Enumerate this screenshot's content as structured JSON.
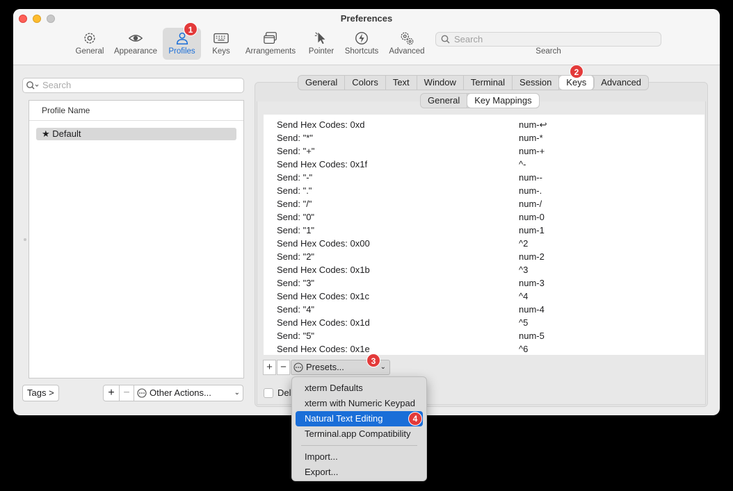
{
  "window": {
    "title": "Preferences"
  },
  "toolbar": {
    "items": [
      {
        "label": "General",
        "icon": "gear-icon"
      },
      {
        "label": "Appearance",
        "icon": "eye-icon"
      },
      {
        "label": "Profiles",
        "icon": "person-icon",
        "active": true
      },
      {
        "label": "Keys",
        "icon": "keyboard-icon"
      },
      {
        "label": "Arrangements",
        "icon": "windows-icon"
      },
      {
        "label": "Pointer",
        "icon": "pointer-icon"
      },
      {
        "label": "Shortcuts",
        "icon": "bolt-icon"
      },
      {
        "label": "Advanced",
        "icon": "gears-icon"
      }
    ],
    "search_placeholder": "Search",
    "search_label": "Search"
  },
  "badges": [
    "1",
    "2",
    "3",
    "4"
  ],
  "left": {
    "search_placeholder": "Search",
    "column_header": "Profile Name",
    "profiles": [
      {
        "name": "Default",
        "icon": "star-icon"
      }
    ],
    "tags_button": "Tags >",
    "add": "+",
    "remove": "−",
    "other_actions": "Other Actions..."
  },
  "tabs": [
    "General",
    "Colors",
    "Text",
    "Window",
    "Terminal",
    "Session",
    "Keys",
    "Advanced"
  ],
  "selected_tab": "Keys",
  "subtabs": [
    "General",
    "Key Mappings"
  ],
  "selected_subtab": "Key Mappings",
  "mappings": [
    {
      "action": "Send Hex Codes: 0xd",
      "key": "num-↩"
    },
    {
      "action": "Send: \"*\"",
      "key": "num-*"
    },
    {
      "action": "Send: \"+\"",
      "key": "num-+"
    },
    {
      "action": "Send Hex Codes: 0x1f",
      "key": "^-"
    },
    {
      "action": "Send: \"-\"",
      "key": "num--"
    },
    {
      "action": "Send: \".\"",
      "key": "num-."
    },
    {
      "action": "Send: \"/\"",
      "key": "num-/"
    },
    {
      "action": "Send: \"0\"",
      "key": "num-0"
    },
    {
      "action": "Send: \"1\"",
      "key": "num-1"
    },
    {
      "action": "Send Hex Codes: 0x00",
      "key": "^2"
    },
    {
      "action": "Send: \"2\"",
      "key": "num-2"
    },
    {
      "action": "Send Hex Codes: 0x1b",
      "key": "^3"
    },
    {
      "action": "Send: \"3\"",
      "key": "num-3"
    },
    {
      "action": "Send Hex Codes: 0x1c",
      "key": "^4"
    },
    {
      "action": "Send: \"4\"",
      "key": "num-4"
    },
    {
      "action": "Send Hex Codes: 0x1d",
      "key": "^5"
    },
    {
      "action": "Send: \"5\"",
      "key": "num-5"
    },
    {
      "action": "Send Hex Codes: 0x1e",
      "key": "^6"
    }
  ],
  "mapping_controls": {
    "add": "+",
    "remove": "−",
    "presets": "Presets..."
  },
  "checkbox_label": "Del",
  "presets_menu": {
    "items": [
      "xterm Defaults",
      "xterm with Numeric Keypad",
      "Natural Text Editing",
      "Terminal.app Compatibility"
    ],
    "highlighted": "Natural Text Editing",
    "extra": [
      "Import...",
      "Export..."
    ]
  },
  "colors": {
    "accent": "#1a6ed8",
    "badge": "#e33a3a"
  }
}
